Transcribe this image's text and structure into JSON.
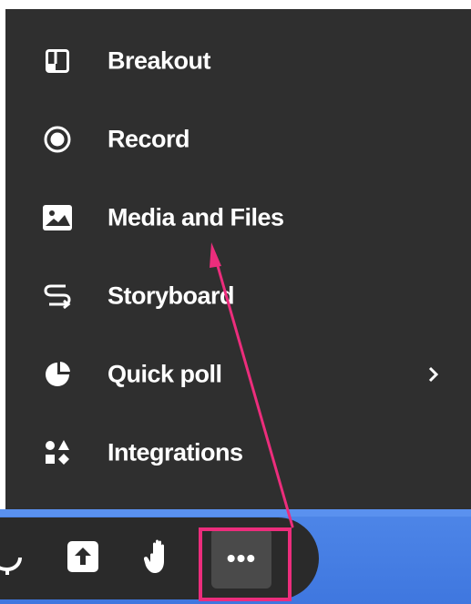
{
  "menu": {
    "items": [
      {
        "label": "Breakout",
        "icon": "breakout-icon"
      },
      {
        "label": "Record",
        "icon": "record-icon"
      },
      {
        "label": "Media and Files",
        "icon": "image-icon"
      },
      {
        "label": "Storyboard",
        "icon": "storyboard-icon"
      },
      {
        "label": "Quick poll",
        "icon": "pie-chart-icon",
        "has_submenu": true
      },
      {
        "label": "Integrations",
        "icon": "integrations-icon"
      }
    ],
    "submenu_indicator": "›"
  },
  "toolbar": {
    "items": [
      {
        "icon": "microphone-icon"
      },
      {
        "icon": "share-icon"
      },
      {
        "icon": "raise-hand-icon"
      },
      {
        "icon": "more-icon",
        "label": "•••"
      }
    ]
  },
  "colors": {
    "panel": "#2f2f2f",
    "toolbar": "#2a2a2a",
    "text": "#ffffff",
    "highlight": "#ec2d7c",
    "background_blue": "#4e86e8"
  }
}
